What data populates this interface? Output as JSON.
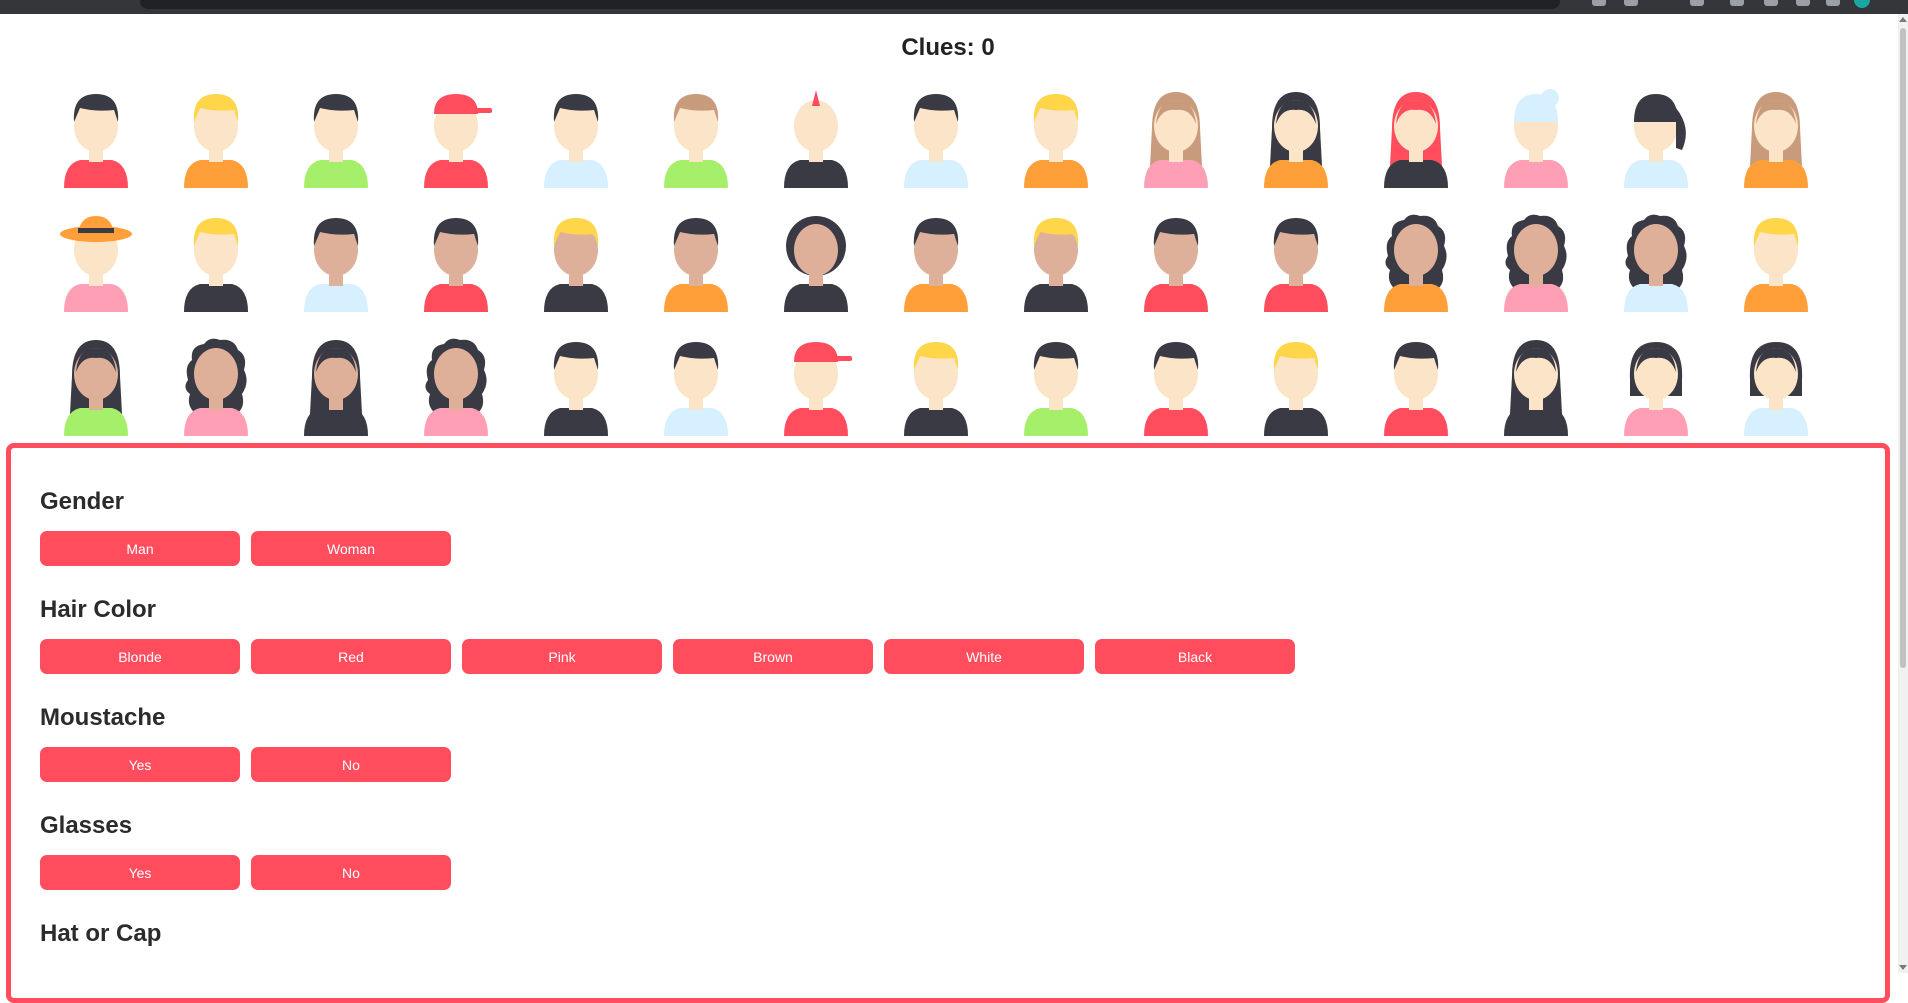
{
  "header": {
    "clues_text": "Clues: 0"
  },
  "board": {
    "characters": [
      {
        "skin": "#fce4c8",
        "hair": "#3a3a44",
        "shirt": "#ff4d5e",
        "style": "short"
      },
      {
        "skin": "#fce4c8",
        "hair": "#ffd54a",
        "shirt": "#ff9f3a",
        "style": "short"
      },
      {
        "skin": "#fce4c8",
        "hair": "#3a3a44",
        "shirt": "#a6ef6a",
        "style": "short"
      },
      {
        "skin": "#fce4c8",
        "hair": "#ff4d5e",
        "shirt": "#ff4d5e",
        "style": "cap"
      },
      {
        "skin": "#fce4c8",
        "hair": "#3a3a44",
        "shirt": "#d7f0ff",
        "style": "short"
      },
      {
        "skin": "#fce4c8",
        "hair": "#c99b7d",
        "shirt": "#a6ef6a",
        "style": "short"
      },
      {
        "skin": "#fce4c8",
        "hair": "#ff4d5e",
        "shirt": "#3a3a44",
        "style": "mohawk"
      },
      {
        "skin": "#fce4c8",
        "hair": "#3a3a44",
        "shirt": "#d7f0ff",
        "style": "short"
      },
      {
        "skin": "#fce4c8",
        "hair": "#ffd54a",
        "shirt": "#ff9f3a",
        "style": "short"
      },
      {
        "skin": "#fce4c8",
        "hair": "#c99b7d",
        "shirt": "#ff9fb5",
        "style": "long"
      },
      {
        "skin": "#fce4c8",
        "hair": "#3a3a44",
        "shirt": "#ff9f3a",
        "style": "long"
      },
      {
        "skin": "#fce4c8",
        "hair": "#ff4d5e",
        "shirt": "#3a3a44",
        "style": "long"
      },
      {
        "skin": "#fce4c8",
        "hair": "#d7f0ff",
        "shirt": "#ff9fb5",
        "style": "bun"
      },
      {
        "skin": "#fce4c8",
        "hair": "#3a3a44",
        "shirt": "#d7f0ff",
        "style": "pony"
      },
      {
        "skin": "#fce4c8",
        "hair": "#c99b7d",
        "shirt": "#ff9f3a",
        "style": "long"
      },
      {
        "skin": "#fce4c8",
        "hair": "#3a3a44",
        "shirt": "#ff9fb5",
        "style": "hat",
        "hat": "#ff9f3a"
      },
      {
        "skin": "#fce4c8",
        "hair": "#ffd54a",
        "shirt": "#3a3a44",
        "style": "short"
      },
      {
        "skin": "#deb09a",
        "hair": "#3a3a44",
        "shirt": "#d7f0ff",
        "style": "short"
      },
      {
        "skin": "#deb09a",
        "hair": "#3a3a44",
        "shirt": "#ff4d5e",
        "style": "short"
      },
      {
        "skin": "#deb09a",
        "hair": "#ffd54a",
        "shirt": "#3a3a44",
        "style": "short"
      },
      {
        "skin": "#deb09a",
        "hair": "#3a3a44",
        "shirt": "#ff9f3a",
        "style": "short"
      },
      {
        "skin": "#deb09a",
        "hair": "#3a3a44",
        "shirt": "#3a3a44",
        "style": "afro"
      },
      {
        "skin": "#deb09a",
        "hair": "#3a3a44",
        "shirt": "#ff9f3a",
        "style": "short"
      },
      {
        "skin": "#deb09a",
        "hair": "#ffd54a",
        "shirt": "#3a3a44",
        "style": "short"
      },
      {
        "skin": "#deb09a",
        "hair": "#3a3a44",
        "shirt": "#ff4d5e",
        "style": "short"
      },
      {
        "skin": "#deb09a",
        "hair": "#3a3a44",
        "shirt": "#ff4d5e",
        "style": "short"
      },
      {
        "skin": "#deb09a",
        "hair": "#3a3a44",
        "shirt": "#ff9f3a",
        "style": "curly"
      },
      {
        "skin": "#deb09a",
        "hair": "#3a3a44",
        "shirt": "#ff9fb5",
        "style": "curly"
      },
      {
        "skin": "#deb09a",
        "hair": "#3a3a44",
        "shirt": "#d7f0ff",
        "style": "curly"
      },
      {
        "skin": "#fce4c8",
        "hair": "#ffd54a",
        "shirt": "#ff9f3a",
        "style": "short"
      },
      {
        "skin": "#deb09a",
        "hair": "#3a3a44",
        "shirt": "#a6ef6a",
        "style": "long"
      },
      {
        "skin": "#deb09a",
        "hair": "#3a3a44",
        "shirt": "#ff9fb5",
        "style": "curly"
      },
      {
        "skin": "#deb09a",
        "hair": "#3a3a44",
        "shirt": "#3a3a44",
        "style": "long"
      },
      {
        "skin": "#deb09a",
        "hair": "#3a3a44",
        "shirt": "#ff9fb5",
        "style": "curly"
      },
      {
        "skin": "#fce4c8",
        "hair": "#3a3a44",
        "shirt": "#3a3a44",
        "style": "short"
      },
      {
        "skin": "#fce4c8",
        "hair": "#3a3a44",
        "shirt": "#d7f0ff",
        "style": "short"
      },
      {
        "skin": "#fce4c8",
        "hair": "#ff4d5e",
        "shirt": "#ff4d5e",
        "style": "cap"
      },
      {
        "skin": "#fce4c8",
        "hair": "#ffd54a",
        "shirt": "#3a3a44",
        "style": "short"
      },
      {
        "skin": "#fce4c8",
        "hair": "#3a3a44",
        "shirt": "#a6ef6a",
        "style": "short"
      },
      {
        "skin": "#fce4c8",
        "hair": "#3a3a44",
        "shirt": "#ff4d5e",
        "style": "short"
      },
      {
        "skin": "#fce4c8",
        "hair": "#ffd54a",
        "shirt": "#3a3a44",
        "style": "short"
      },
      {
        "skin": "#fce4c8",
        "hair": "#3a3a44",
        "shirt": "#ff4d5e",
        "style": "short"
      },
      {
        "skin": "#fce4c8",
        "hair": "#3a3a44",
        "shirt": "#3a3a44",
        "style": "long"
      },
      {
        "skin": "#fce4c8",
        "hair": "#3a3a44",
        "shirt": "#ff9fb5",
        "style": "bob"
      },
      {
        "skin": "#fce4c8",
        "hair": "#3a3a44",
        "shirt": "#d7f0ff",
        "style": "bob"
      }
    ]
  },
  "questions": {
    "gender": {
      "title": "Gender",
      "options": [
        "Man",
        "Woman"
      ]
    },
    "hair_color": {
      "title": "Hair Color",
      "options": [
        "Blonde",
        "Red",
        "Pink",
        "Brown",
        "White",
        "Black"
      ]
    },
    "moustache": {
      "title": "Moustache",
      "options": [
        "Yes",
        "No"
      ]
    },
    "glasses": {
      "title": "Glasses",
      "options": [
        "Yes",
        "No"
      ]
    },
    "hat": {
      "title": "Hat or Cap"
    }
  },
  "colors": {
    "accent": "#ff4d5e"
  }
}
